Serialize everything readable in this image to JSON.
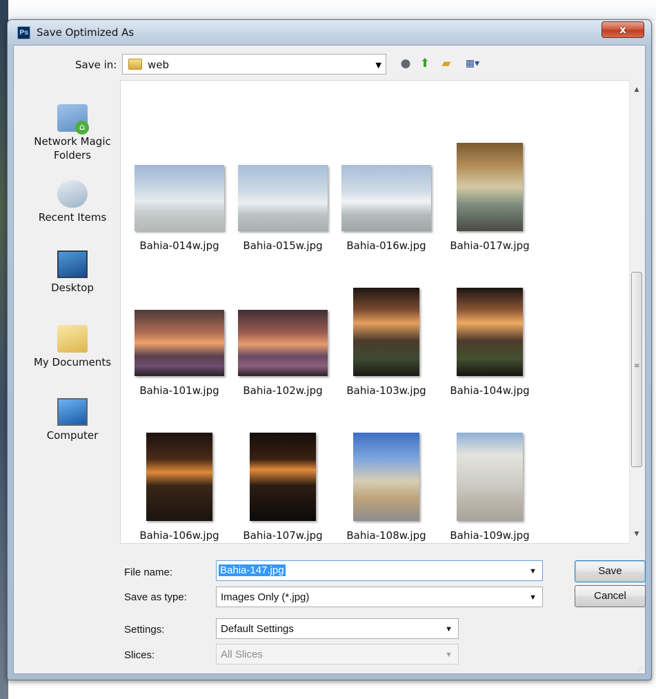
{
  "window": {
    "title": "Save Optimized As",
    "app_icon": "Ps",
    "close_glyph": "x"
  },
  "toolbar": {
    "save_in_label": "Save in:",
    "save_in_value": "web",
    "back_icon": "back-icon",
    "up_icon": "up-folder-icon",
    "new_folder_icon": "new-folder-icon",
    "views_icon": "views-menu-icon"
  },
  "places": [
    {
      "label": "Network Magic Folders",
      "icon": "network-magic-folders-icon"
    },
    {
      "label": "Recent Items",
      "icon": "recent-items-icon"
    },
    {
      "label": "Desktop",
      "icon": "desktop-icon"
    },
    {
      "label": "My Documents",
      "icon": "my-documents-icon"
    },
    {
      "label": "Computer",
      "icon": "computer-icon"
    }
  ],
  "files": [
    {
      "name": "Bahia-014w.jpg"
    },
    {
      "name": "Bahia-015w.jpg"
    },
    {
      "name": "Bahia-016w.jpg"
    },
    {
      "name": "Bahia-017w.jpg"
    },
    {
      "name": "Bahia-101w.jpg"
    },
    {
      "name": "Bahia-102w.jpg"
    },
    {
      "name": "Bahia-103w.jpg"
    },
    {
      "name": "Bahia-104w.jpg"
    },
    {
      "name": "Bahia-106w.jpg"
    },
    {
      "name": "Bahia-107w.jpg"
    },
    {
      "name": "Bahia-108w.jpg"
    },
    {
      "name": "Bahia-109w.jpg"
    }
  ],
  "form": {
    "file_name_label": "File name:",
    "file_name_value": "Bahia-147.jpg",
    "save_as_type_label": "Save as type:",
    "save_as_type_value": "Images Only (*.jpg)",
    "settings_label": "Settings:",
    "settings_value": "Default Settings",
    "slices_label": "Slices:",
    "slices_value": "All Slices"
  },
  "buttons": {
    "save": "Save",
    "cancel": "Cancel"
  }
}
